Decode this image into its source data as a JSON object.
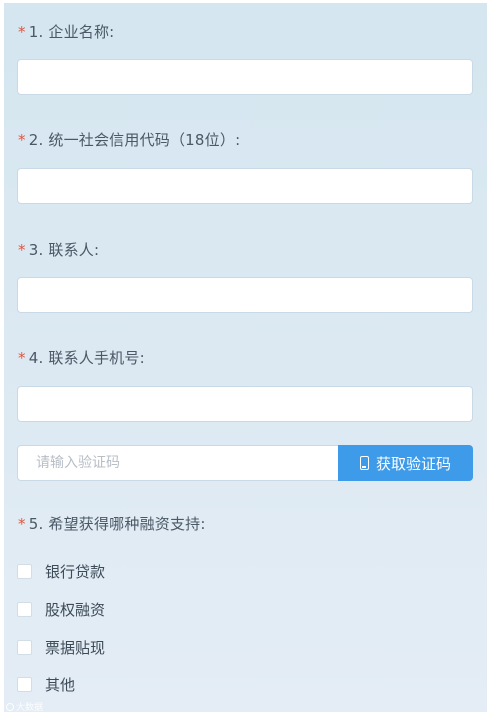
{
  "form": {
    "required_mark": "*",
    "q1": {
      "label": "1. 企业名称:",
      "value": ""
    },
    "q2": {
      "label": "2. 统一社会信用代码（18位）:",
      "value": ""
    },
    "q3": {
      "label": "3. 联系人:",
      "value": ""
    },
    "q4": {
      "label": "4. 联系人手机号:",
      "value": ""
    },
    "verification": {
      "placeholder": "请输入验证码",
      "button_label": "获取验证码",
      "button_icon": "phone-icon"
    },
    "q5": {
      "label": "5. 希望获得哪种融资支持:",
      "options": [
        {
          "label": "银行贷款",
          "checked": false
        },
        {
          "label": "股权融资",
          "checked": false
        },
        {
          "label": "票据贴现",
          "checked": false
        },
        {
          "label": "其他",
          "checked": false
        }
      ]
    }
  },
  "watermark": {
    "text": "大数据"
  },
  "colors": {
    "accent": "#3d9be9",
    "required": "#e8533a",
    "background": "#d9e8f2"
  }
}
